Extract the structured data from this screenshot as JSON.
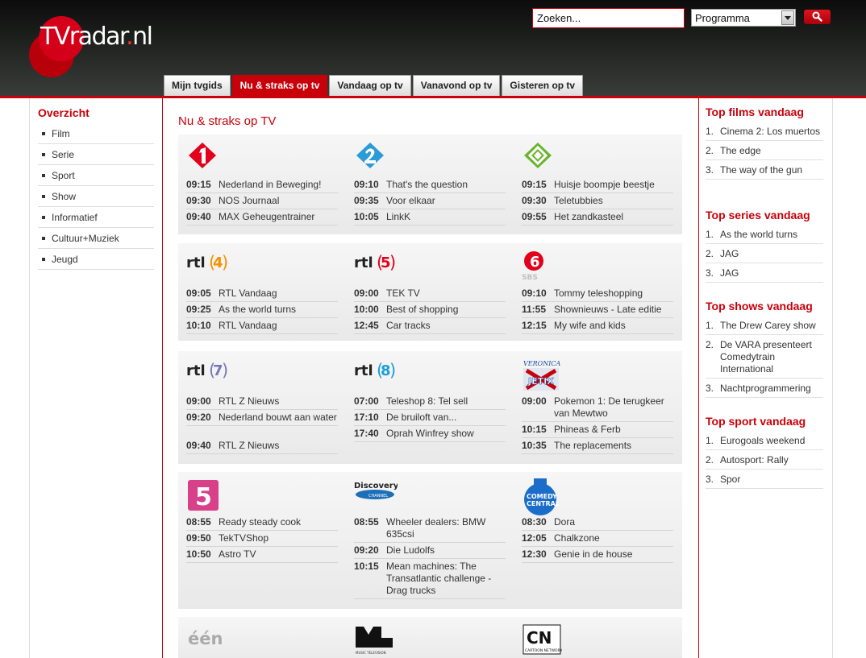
{
  "header": {
    "logo": {
      "brand": "TVradar",
      "dot": ".",
      "tld": "nl"
    },
    "search": {
      "value": "Zoeken...",
      "placeholder": "Zoeken..."
    },
    "select": {
      "selected": "Programma"
    },
    "tabs": [
      {
        "label": "Mijn tvgids"
      },
      {
        "label": "Nu & straks op tv"
      },
      {
        "label": "Vandaag op tv"
      },
      {
        "label": "Vanavond op tv"
      },
      {
        "label": "Gisteren op tv"
      }
    ]
  },
  "sidebar": {
    "title": "Overzicht",
    "items": [
      "Film",
      "Serie",
      "Sport",
      "Show",
      "Informatief",
      "Cultuur+Muziek",
      "Jeugd"
    ]
  },
  "main": {
    "title": "Nu & straks op TV",
    "channels": [
      {
        "logo": "ned1",
        "programs": [
          {
            "time": "09:15",
            "name": "Nederland in Beweging!"
          },
          {
            "time": "09:30",
            "name": "NOS Journaal"
          },
          {
            "time": "09:40",
            "name": "MAX Geheugentrainer"
          }
        ]
      },
      {
        "logo": "ned2",
        "programs": [
          {
            "time": "09:10",
            "name": "That's the question"
          },
          {
            "time": "09:35",
            "name": "Voor elkaar"
          },
          {
            "time": "10:05",
            "name": "LinkK"
          }
        ]
      },
      {
        "logo": "ned3",
        "programs": [
          {
            "time": "09:15",
            "name": "Huisje boompje beestje"
          },
          {
            "time": "09:30",
            "name": "Teletubbies"
          },
          {
            "time": "09:55",
            "name": "Het zandkasteel"
          }
        ]
      },
      {
        "logo": "rtl4",
        "label": "rtl",
        "num": "4",
        "programs": [
          {
            "time": "09:05",
            "name": "RTL Vandaag"
          },
          {
            "time": "09:25",
            "name": "As the world turns"
          },
          {
            "time": "10:10",
            "name": "RTL Vandaag"
          }
        ]
      },
      {
        "logo": "rtl5",
        "label": "rtl",
        "num": "5",
        "programs": [
          {
            "time": "09:00",
            "name": "TEK TV"
          },
          {
            "time": "10:00",
            "name": "Best of shopping"
          },
          {
            "time": "12:45",
            "name": "Car tracks"
          }
        ]
      },
      {
        "logo": "sbs6",
        "label": "SBS",
        "num": "6",
        "programs": [
          {
            "time": "09:10",
            "name": "Tommy teleshopping"
          },
          {
            "time": "11:55",
            "name": "Shownieuws - Late editie"
          },
          {
            "time": "12:15",
            "name": "My wife and kids"
          }
        ]
      },
      {
        "logo": "rtl7",
        "label": "rtl",
        "num": "7",
        "programs": [
          {
            "time": "09:00",
            "name": "RTL Z Nieuws"
          },
          {
            "time": "09:20",
            "name": "Nederland bouwt aan water"
          },
          {
            "time": "09:40",
            "name": "RTL Z Nieuws"
          }
        ]
      },
      {
        "logo": "rtl8",
        "label": "rtl",
        "num": "8",
        "programs": [
          {
            "time": "07:00",
            "name": "Teleshop 8: Tel sell"
          },
          {
            "time": "17:10",
            "name": "De bruiloft van..."
          },
          {
            "time": "17:40",
            "name": "Oprah Winfrey show"
          }
        ]
      },
      {
        "logo": "veronica",
        "label": "VERONICA",
        "sub": "JETIX",
        "programs": [
          {
            "time": "09:00",
            "name": "Pokemon 1: De terugkeer van Mewtwo"
          },
          {
            "time": "10:15",
            "name": "Phineas & Ferb"
          },
          {
            "time": "10:35",
            "name": "The replacements"
          }
        ]
      },
      {
        "logo": "net5",
        "label": "5",
        "programs": [
          {
            "time": "08:55",
            "name": "Ready steady cook"
          },
          {
            "time": "09:50",
            "name": "TekTVShop"
          },
          {
            "time": "10:50",
            "name": "Astro TV"
          }
        ]
      },
      {
        "logo": "discovery",
        "label": "Discovery",
        "sub": "CHANNEL",
        "programs": [
          {
            "time": "08:55",
            "name": "Wheeler dealers: BMW 635csi"
          },
          {
            "time": "09:20",
            "name": "Die Ludolfs"
          },
          {
            "time": "10:15",
            "name": "Mean machines: The Transatlantic challenge - Drag trucks"
          }
        ]
      },
      {
        "logo": "comedy",
        "label": "COMEDY",
        "sub": "CENTRAL",
        "programs": [
          {
            "time": "08:30",
            "name": "Dora"
          },
          {
            "time": "12:05",
            "name": "Chalkzone"
          },
          {
            "time": "12:30",
            "name": "Genie in de house"
          }
        ]
      },
      {
        "logo": "een",
        "label": "één",
        "programs": []
      },
      {
        "logo": "mtv",
        "label": "MTV",
        "sub": "MUSIC TELEVISION",
        "programs": []
      },
      {
        "logo": "cn",
        "label": "CN",
        "sub": "CARTOON NETWORK",
        "programs": []
      }
    ]
  },
  "right": {
    "blocks": [
      {
        "title": "Top films vandaag",
        "items": [
          "Cinema 2: Los muertos",
          "The edge",
          "The way of the gun"
        ]
      },
      {
        "title": "Top series vandaag",
        "items": [
          "As the world turns",
          "JAG",
          "JAG"
        ]
      },
      {
        "title": "Top shows vandaag",
        "items": [
          "The Drew Carey show",
          "De VARA presenteert Comedytrain International",
          "Nachtprogrammering"
        ]
      },
      {
        "title": "Top sport vandaag",
        "items": [
          "Eurogoals weekend",
          "Autosport: Rally",
          "Spor"
        ]
      }
    ]
  },
  "colors": {
    "accent": "#c8000a"
  }
}
